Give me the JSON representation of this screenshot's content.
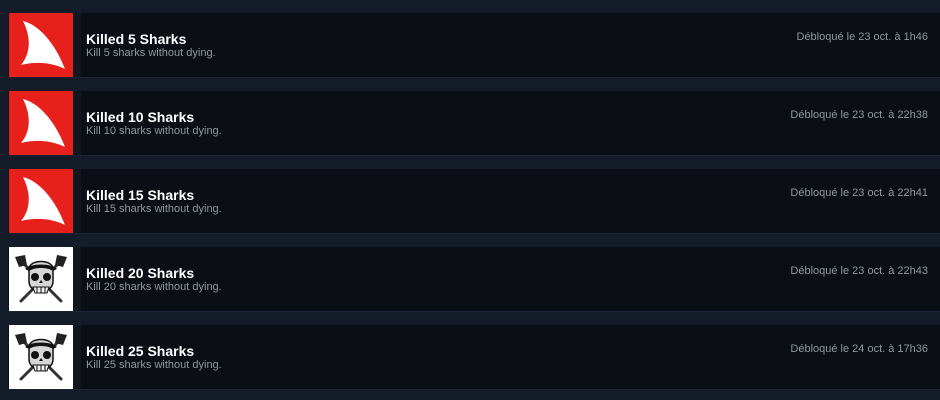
{
  "achievements": [
    {
      "title": "Killed 5 Sharks",
      "description": "Kill 5 sharks without dying.",
      "unlocked": "Débloqué le 23 oct. à 1h46",
      "icon": "shark-fin-icon"
    },
    {
      "title": "Killed 10 Sharks",
      "description": "Kill 10 sharks without dying.",
      "unlocked": "Débloqué le 23 oct. à 22h38",
      "icon": "shark-fin-icon"
    },
    {
      "title": "Killed 15 Sharks",
      "description": "Kill 15 sharks without dying.",
      "unlocked": "Débloqué le 23 oct. à 22h41",
      "icon": "shark-fin-icon"
    },
    {
      "title": "Killed 20 Sharks",
      "description": "Kill 20 sharks without dying.",
      "unlocked": "Débloqué le 23 oct. à 22h43",
      "icon": "pirate-skull-axes-icon"
    },
    {
      "title": "Killed 25 Sharks",
      "description": "Kill 25 sharks without dying.",
      "unlocked": "Débloqué le 24 oct. à 17h36",
      "icon": "pirate-skull-axes-icon"
    }
  ],
  "colors": {
    "page_background": "#141c29",
    "row_background": "#0b0e14",
    "shark_icon_background": "#e8201c",
    "skull_icon_background": "#ffffff",
    "title_text": "#ffffff",
    "muted_text": "#8f98a0"
  }
}
